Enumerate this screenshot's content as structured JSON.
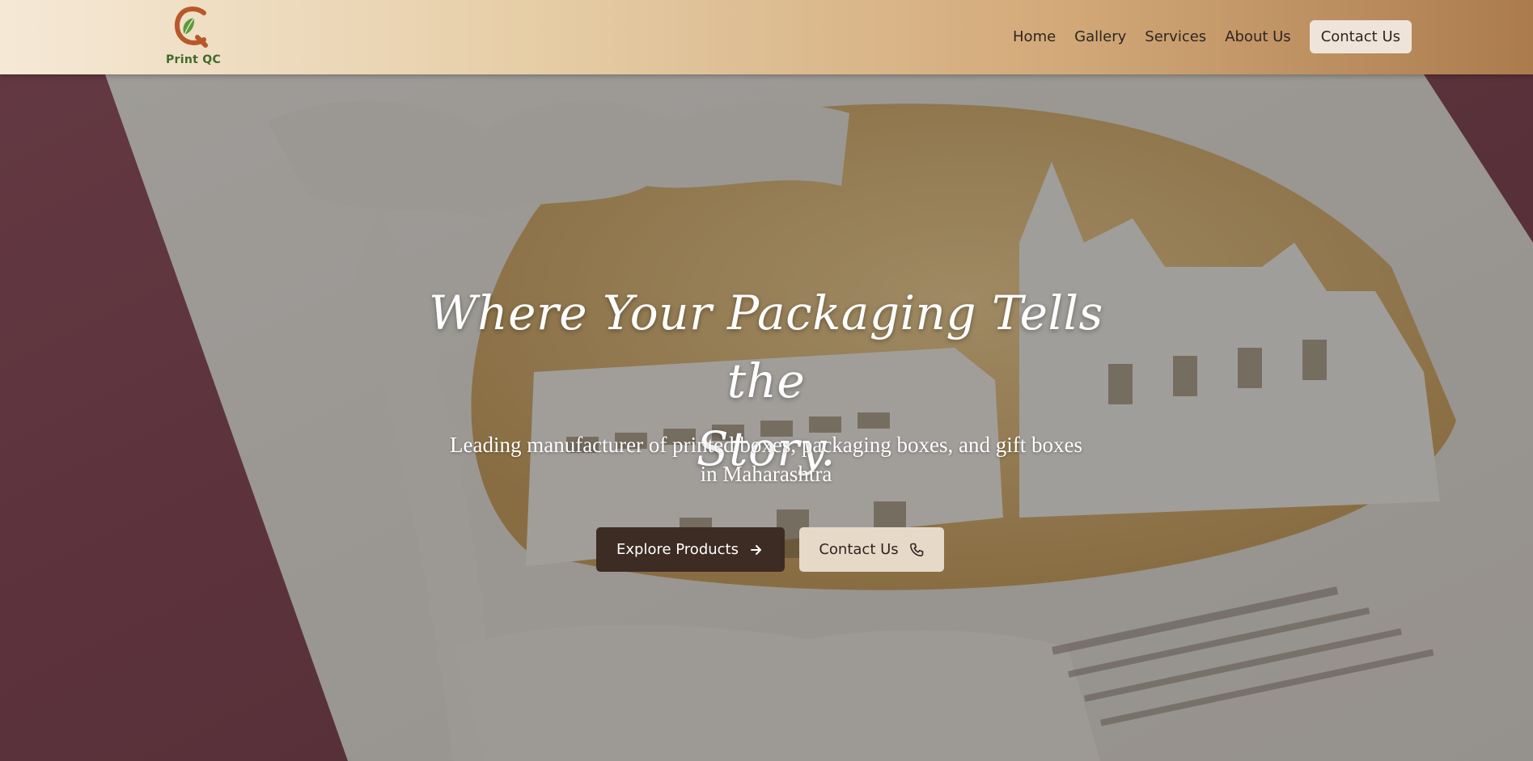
{
  "brand": {
    "name": "Print QC",
    "colors": {
      "leaf": "#5c9a3a",
      "ring": "#b8582a",
      "text": "#3f6a2a"
    }
  },
  "nav": {
    "items": [
      {
        "label": "Home"
      },
      {
        "label": "Gallery"
      },
      {
        "label": "Services"
      },
      {
        "label": "About Us"
      }
    ],
    "cta_label": "Contact Us"
  },
  "hero": {
    "headline_line1": "Where Your Packaging Tells the",
    "headline_line2": "Story.",
    "subhead_line1": "Leading manufacturer of printed boxes, packaging boxes, and gift boxes",
    "subhead_line2": "in Maharashtra",
    "primary_button": {
      "label": "Explore Products",
      "icon": "arrow-right-icon"
    },
    "secondary_button": {
      "label": "Contact Us",
      "icon": "phone-icon"
    },
    "background_image": "paper-cut temple artwork on maroon surface"
  },
  "colors": {
    "primary_button_bg": "#3d2c23",
    "secondary_button_bg": "#e6d9c8",
    "nav_gradient_start": "#f5e9d6",
    "nav_gradient_end": "#ab7b4e"
  }
}
